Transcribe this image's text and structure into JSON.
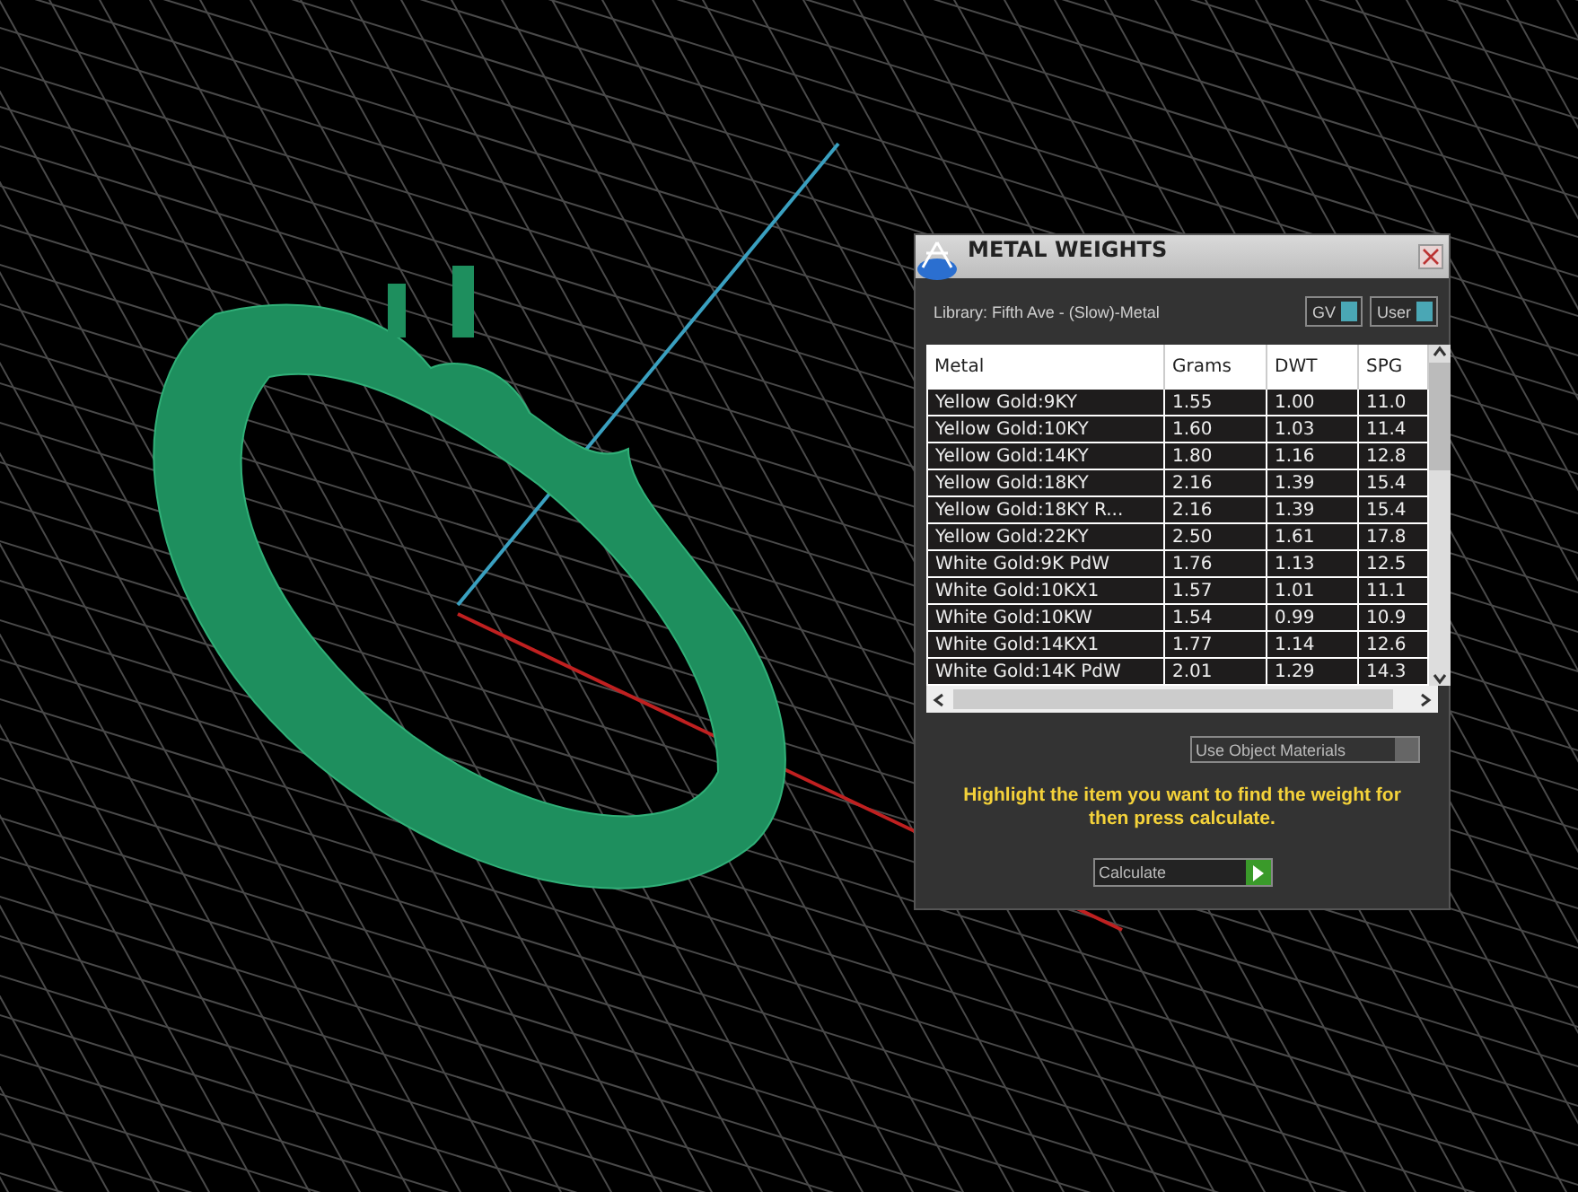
{
  "window": {
    "title": "METAL WEIGHTS"
  },
  "library": "Library: Fifth Ave - (Slow)-Metal",
  "toggles": [
    {
      "label": "GV",
      "on": true
    },
    {
      "label": "User",
      "on": true
    }
  ],
  "table": {
    "columns": [
      "Metal",
      "Grams",
      "DWT",
      "SPG"
    ],
    "rows": [
      [
        "Yellow Gold:9KY",
        "1.55",
        "1.00",
        "11.0"
      ],
      [
        "Yellow Gold:10KY",
        "1.60",
        "1.03",
        "11.4"
      ],
      [
        "Yellow Gold:14KY",
        "1.80",
        "1.16",
        "12.8"
      ],
      [
        "Yellow Gold:18KY",
        "2.16",
        "1.39",
        "15.4"
      ],
      [
        "Yellow Gold:18KY R...",
        "2.16",
        "1.39",
        "15.4"
      ],
      [
        "Yellow Gold:22KY",
        "2.50",
        "1.61",
        "17.8"
      ],
      [
        "White Gold:9K PdW",
        "1.76",
        "1.13",
        "12.5"
      ],
      [
        "White Gold:10KX1",
        "1.57",
        "1.01",
        "11.1"
      ],
      [
        "White Gold:10KW",
        "1.54",
        "0.99",
        "10.9"
      ],
      [
        "White Gold:14KX1",
        "1.77",
        "1.14",
        "12.6"
      ],
      [
        "White Gold:14K PdW",
        "2.01",
        "1.29",
        "14.3"
      ]
    ]
  },
  "use_object_materials": {
    "label": "Use Object Materials",
    "checked": false
  },
  "hint": "Highlight the item you want to find the weight for then press calculate.",
  "calculate": {
    "label": "Calculate"
  }
}
